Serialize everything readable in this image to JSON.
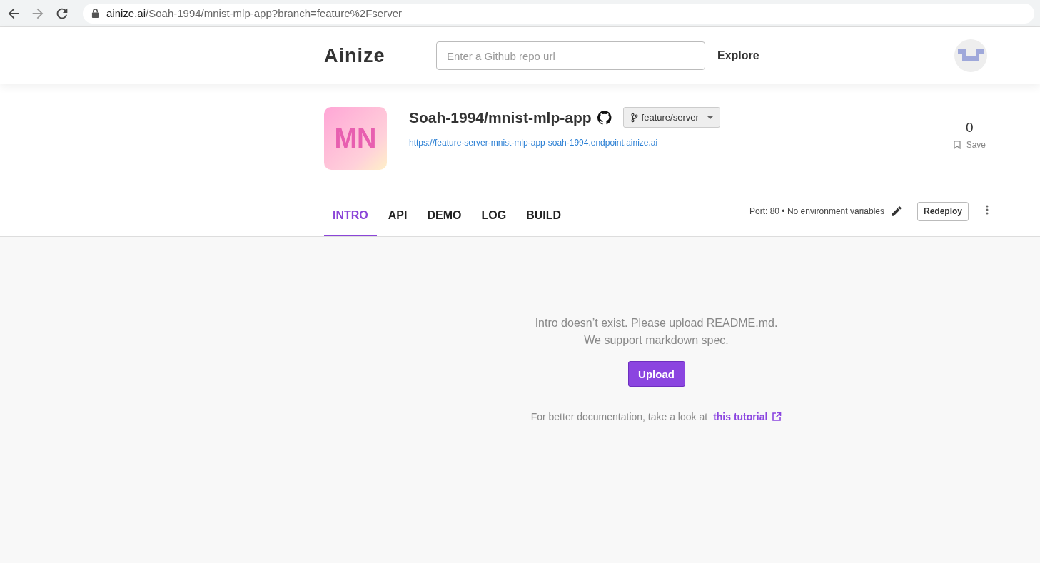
{
  "browser": {
    "url_host": "ainize.ai",
    "url_path": "/Soah-1994/mnist-mlp-app?branch=feature%2Fserver"
  },
  "header": {
    "logo": "Ainize",
    "search": {
      "placeholder": "Enter a Github repo url"
    },
    "nav_link": "Explore"
  },
  "project": {
    "initials": "MN",
    "name": "Soah-1994/mnist-mlp-app",
    "branch": "feature/server",
    "endpoint": "https://feature-server-mnist-mlp-app-soah-1994.endpoint.ainize.ai",
    "save_count": "0",
    "save_label": "Save"
  },
  "tabs": [
    {
      "label": "INTRO",
      "selected": true
    },
    {
      "label": "API",
      "selected": false
    },
    {
      "label": "DEMO",
      "selected": false
    },
    {
      "label": "LOG",
      "selected": false
    },
    {
      "label": "BUILD",
      "selected": false
    }
  ],
  "settings": {
    "summary": "Port: 80 • No environment variables",
    "redeploy": "Redeploy"
  },
  "intro": {
    "message_lines": [
      "Intro doesn’t exist. Please upload README.md.",
      "We support markdown spec."
    ],
    "upload": "Upload",
    "tutorial_text": "For better documentation, take a look at",
    "tutorial_link": "this tutorial"
  }
}
